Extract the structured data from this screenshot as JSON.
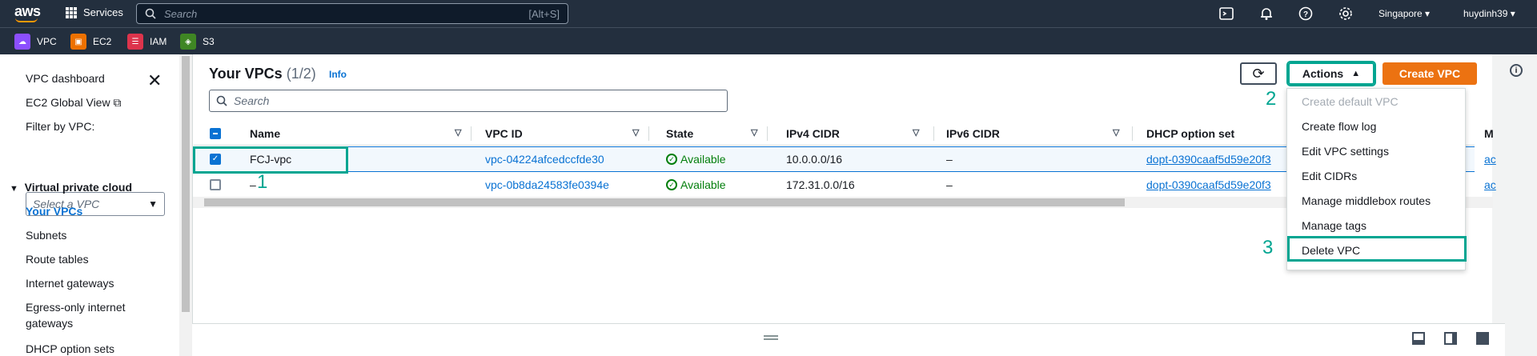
{
  "topnav": {
    "logo": "aws",
    "services": "Services",
    "search_placeholder": "Search",
    "search_hint": "[Alt+S]",
    "region": "Singapore ▾",
    "user": "huydinh39 ▾"
  },
  "favorites": [
    {
      "label": "VPC",
      "color": "#8c4fff"
    },
    {
      "label": "EC2",
      "color": "#ed7100"
    },
    {
      "label": "IAM",
      "color": "#dd344c"
    },
    {
      "label": "S3",
      "color": "#3f8624"
    }
  ],
  "sidebar": {
    "dashboard": "VPC dashboard",
    "ec2_global": "EC2 Global View",
    "filter_label": "Filter by VPC:",
    "filter_placeholder": "Select a VPC",
    "section": "Virtual private cloud",
    "items": [
      "Your VPCs",
      "Subnets",
      "Route tables",
      "Internet gateways",
      "Egress-only internet",
      "gateways",
      "DHCP option sets"
    ]
  },
  "main": {
    "title": "Your VPCs",
    "count": "(1/2)",
    "info": "Info",
    "actions_label": "Actions",
    "create_label": "Create VPC",
    "search_placeholder": "Search",
    "columns": [
      "Name",
      "VPC ID",
      "State",
      "IPv4 CIDR",
      "IPv6 CIDR",
      "DHCP option set",
      "M"
    ],
    "rows": [
      {
        "name": "FCJ-vpc",
        "vpc_id": "vpc-04224afcedccfde30",
        "state": "Available",
        "ipv4": "10.0.0.0/16",
        "ipv6": "–",
        "dhcp": "dopt-0390caaf5d59e20f3",
        "m": "ac"
      },
      {
        "name": "–",
        "vpc_id": "vpc-0b8da24583fe0394e",
        "state": "Available",
        "ipv4": "172.31.0.0/16",
        "ipv6": "–",
        "dhcp": "dopt-0390caaf5d59e20f3",
        "m": "ac"
      }
    ]
  },
  "dropdown": {
    "items": [
      "Create default VPC",
      "Create flow log",
      "Edit VPC settings",
      "Edit CIDRs",
      "Manage middlebox routes",
      "Manage tags",
      "Delete VPC"
    ]
  },
  "annotations": [
    "1",
    "2",
    "3"
  ]
}
